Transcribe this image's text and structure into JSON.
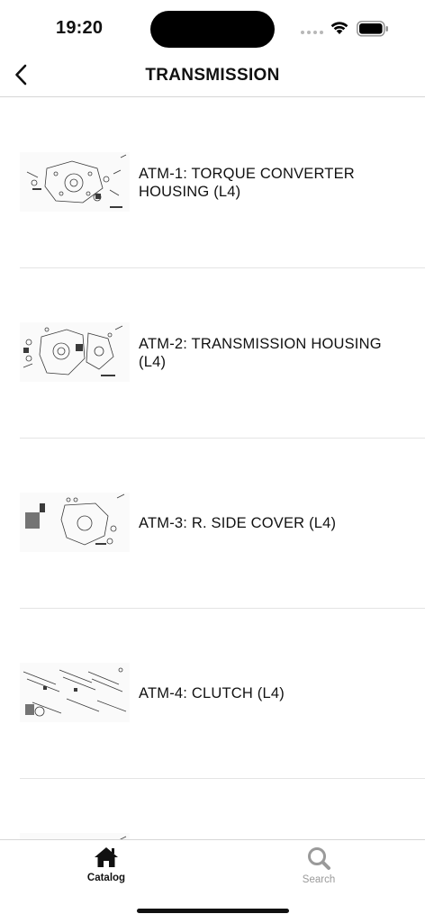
{
  "status_bar": {
    "time": "19:20",
    "signal_icon": "cellular-signal-icon",
    "wifi_icon": "wifi-icon",
    "battery_icon": "battery-icon"
  },
  "nav": {
    "title": "TRANSMISSION",
    "back_icon": "chevron-left-icon"
  },
  "items": [
    {
      "label": "ATM-1: TORQUE CONVERTER HOUSING (L4)",
      "thumbnail": "parts-diagram-thumbnail"
    },
    {
      "label": "ATM-2: TRANSMISSION HOUSING (L4)",
      "thumbnail": "parts-diagram-thumbnail"
    },
    {
      "label": "ATM-3: R. SIDE COVER (L4)",
      "thumbnail": "parts-diagram-thumbnail"
    },
    {
      "label": "ATM-4: CLUTCH (L4)",
      "thumbnail": "parts-diagram-thumbnail"
    },
    {
      "label": "",
      "thumbnail": "parts-diagram-thumbnail"
    }
  ],
  "tabs": [
    {
      "label": "Catalog",
      "icon": "home-icon",
      "active": true
    },
    {
      "label": "Search",
      "icon": "search-icon",
      "active": false
    }
  ],
  "colors": {
    "active_tab": "#111111",
    "inactive_tab": "#9a9a9a",
    "divider": "#e4e4e4"
  }
}
